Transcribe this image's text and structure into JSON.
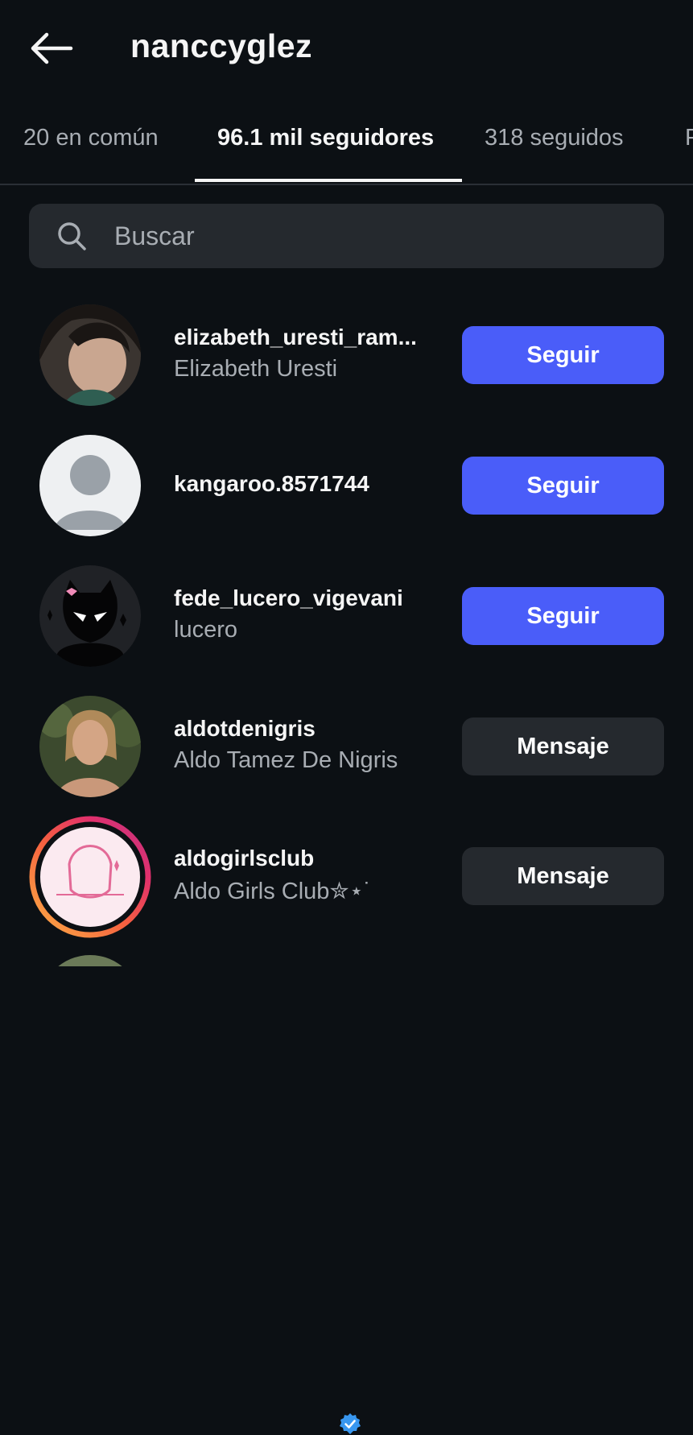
{
  "header": {
    "title": "nanccyglez",
    "back_icon": "arrow-left-icon"
  },
  "tabs": [
    {
      "label": "20 en común",
      "active": false
    },
    {
      "label": "96.1 mil seguidores",
      "active": true
    },
    {
      "label": "318 seguidos",
      "active": false
    },
    {
      "label": "P",
      "active": false
    }
  ],
  "search": {
    "placeholder": "Buscar",
    "value": "",
    "icon": "search-icon"
  },
  "colors": {
    "background": "#0c1014",
    "follow_button": "#4a5df9",
    "message_button": "#25292e",
    "verified": "#3897f0",
    "secondary_text": "#a8adb3"
  },
  "followers": [
    {
      "username": "elizabeth_uresti_ram...",
      "full_name": "Elizabeth Uresti",
      "action": "Seguir",
      "verified": false
    },
    {
      "username": "kangaroo.8571744",
      "full_name": "",
      "action": "Seguir",
      "verified": false
    },
    {
      "username": "fede_lucero_vigevani",
      "full_name": "lucero",
      "action": "Seguir",
      "verified": false
    },
    {
      "username": "aldotdenigris",
      "full_name": "Aldo Tamez De Nigris",
      "action": "Mensaje",
      "verified": true
    },
    {
      "username": "aldogirlsclub",
      "full_name": "Aldo Girls Club✮⋆˙",
      "action": "Mensaje",
      "verified": false,
      "has_story_ring": true
    }
  ]
}
